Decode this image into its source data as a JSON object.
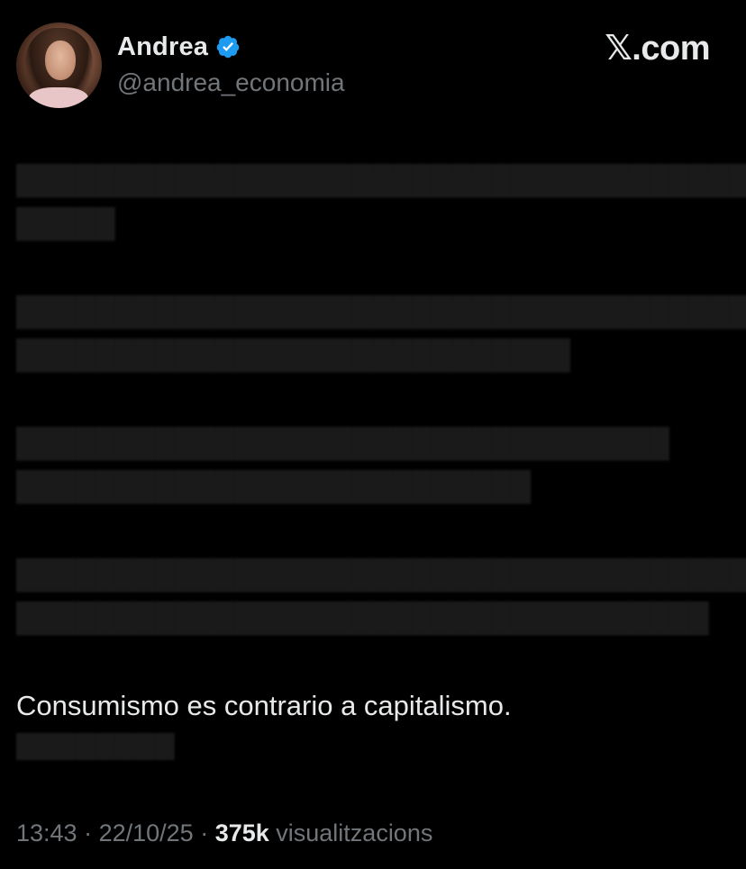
{
  "author": {
    "name": "Andrea",
    "handle": "@andrea_economia",
    "verified_icon": "verified-badge-icon",
    "verified_color": "#1d9bf0"
  },
  "brand": {
    "label": "𝕏.com"
  },
  "post": {
    "visible_line": "Consumismo es contrario a capitalismo."
  },
  "meta": {
    "time": "13:43",
    "separator1": " · ",
    "date": "22/10/25",
    "separator2": " · ",
    "views": "375k",
    "views_label": " visualitzacions"
  },
  "colors": {
    "background": "#000000",
    "text": "#e7e9ea",
    "muted": "#71767b"
  }
}
